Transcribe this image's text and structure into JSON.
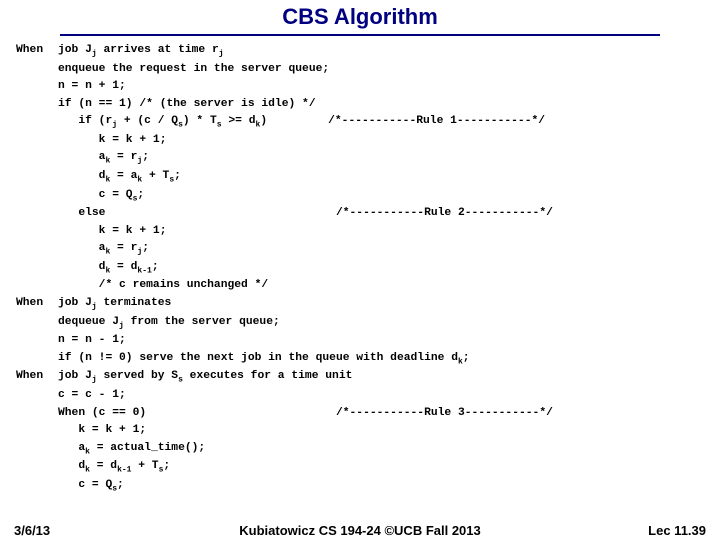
{
  "title": "CBS Algorithm",
  "labels": {
    "when1": "When",
    "when2": "When",
    "when3": "When"
  },
  "code": {
    "b1l1_a": "job J",
    "b1l1_j": "j",
    "b1l1_b": " arrives at time r",
    "b1l1_j2": "j",
    "b1l2": "enqueue the request in the server queue;",
    "b1l3": "n = n + 1;",
    "b1l4": "if (n == 1) /* (the server is idle) */",
    "b1l5_a": "   if (r",
    "b1l5_j": "j",
    "b1l5_b": " + (c / Q",
    "b1l5_s": "s",
    "b1l5_c": ") * T",
    "b1l5_s2": "s",
    "b1l5_d": " >= d",
    "b1l5_k": "k",
    "b1l5_e": ")         /*-----------Rule 1-----------*/",
    "b1l6": "      k = k + 1;",
    "b1l7_a": "      a",
    "b1l7_k": "k",
    "b1l7_b": " = r",
    "b1l7_j": "j",
    "b1l7_c": ";",
    "b1l8_a": "      d",
    "b1l8_k": "k",
    "b1l8_b": " = a",
    "b1l8_k2": "k",
    "b1l8_c": " + T",
    "b1l8_s": "s",
    "b1l8_d": ";",
    "b1l9_a": "      c = Q",
    "b1l9_s": "s",
    "b1l9_b": ";",
    "b1l10": "   else                                  /*-----------Rule 2-----------*/",
    "b1l11": "      k = k + 1;",
    "b1l12_a": "      a",
    "b1l12_k": "k",
    "b1l12_b": " = r",
    "b1l12_j": "j",
    "b1l12_c": ";",
    "b1l13_a": "      d",
    "b1l13_k": "k",
    "b1l13_b": " = d",
    "b1l13_k1": "k-1",
    "b1l13_c": ";",
    "b1l14": "      /* c remains unchanged */",
    "b2l1_a": "job J",
    "b2l1_j": "j",
    "b2l1_b": " terminates",
    "b2l2_a": "dequeue J",
    "b2l2_j": "j",
    "b2l2_b": " from the server queue;",
    "b2l3": "n = n - 1;",
    "b2l4_a": "if (n != 0) serve the next job in the queue with deadline d",
    "b2l4_k": "k",
    "b2l4_b": ";",
    "b3l1_a": "job J",
    "b3l1_j": "j",
    "b3l1_b": " served by S",
    "b3l1_s": "s",
    "b3l1_c": " executes for a time unit",
    "b3l2": "c = c - 1;",
    "b3l3": "When (c == 0)                            /*-----------Rule 3-----------*/",
    "b3l4": "   k = k + 1;",
    "b3l5_a": "   a",
    "b3l5_k": "k",
    "b3l5_b": " = actual_time();",
    "b3l6_a": "   d",
    "b3l6_k": "k",
    "b3l6_b": " = d",
    "b3l6_k1": "k-1",
    "b3l6_c": " + T",
    "b3l6_s": "s",
    "b3l6_d": ";",
    "b3l7_a": "   c = Q",
    "b3l7_s": "s",
    "b3l7_b": ";"
  },
  "footer": {
    "date": "3/6/13",
    "mid": "Kubiatowicz CS 194-24 ©UCB Fall 2013",
    "lec": "Lec 11.39"
  }
}
